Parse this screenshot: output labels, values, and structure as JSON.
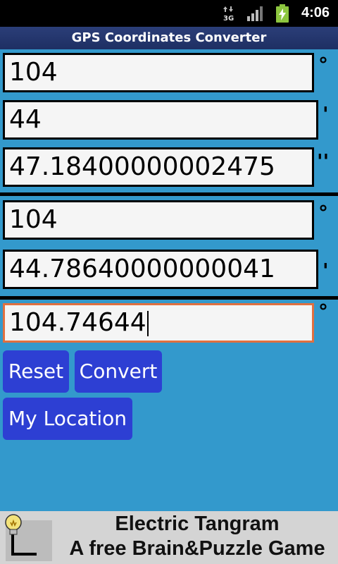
{
  "status_bar": {
    "time": "4:06",
    "network": "3G"
  },
  "app": {
    "title": "GPS Coordinates Converter"
  },
  "dms": {
    "degrees": "104",
    "minutes": "44",
    "seconds": "47.18400000002475"
  },
  "dm": {
    "degrees": "104",
    "minutes": "44.78640000000041"
  },
  "dd": {
    "degrees": "104.74644"
  },
  "units": {
    "degree": "°",
    "minute": "'",
    "second": "''"
  },
  "buttons": {
    "reset": "Reset",
    "convert": "Convert",
    "my_location": "My Location"
  },
  "ad": {
    "line1": "Electric Tangram",
    "line2": "A free Brain&Puzzle Game"
  },
  "colors": {
    "background": "#3399cc",
    "button": "#2d3fd3",
    "title_bar": "#233570",
    "active_border": "#e07040"
  }
}
